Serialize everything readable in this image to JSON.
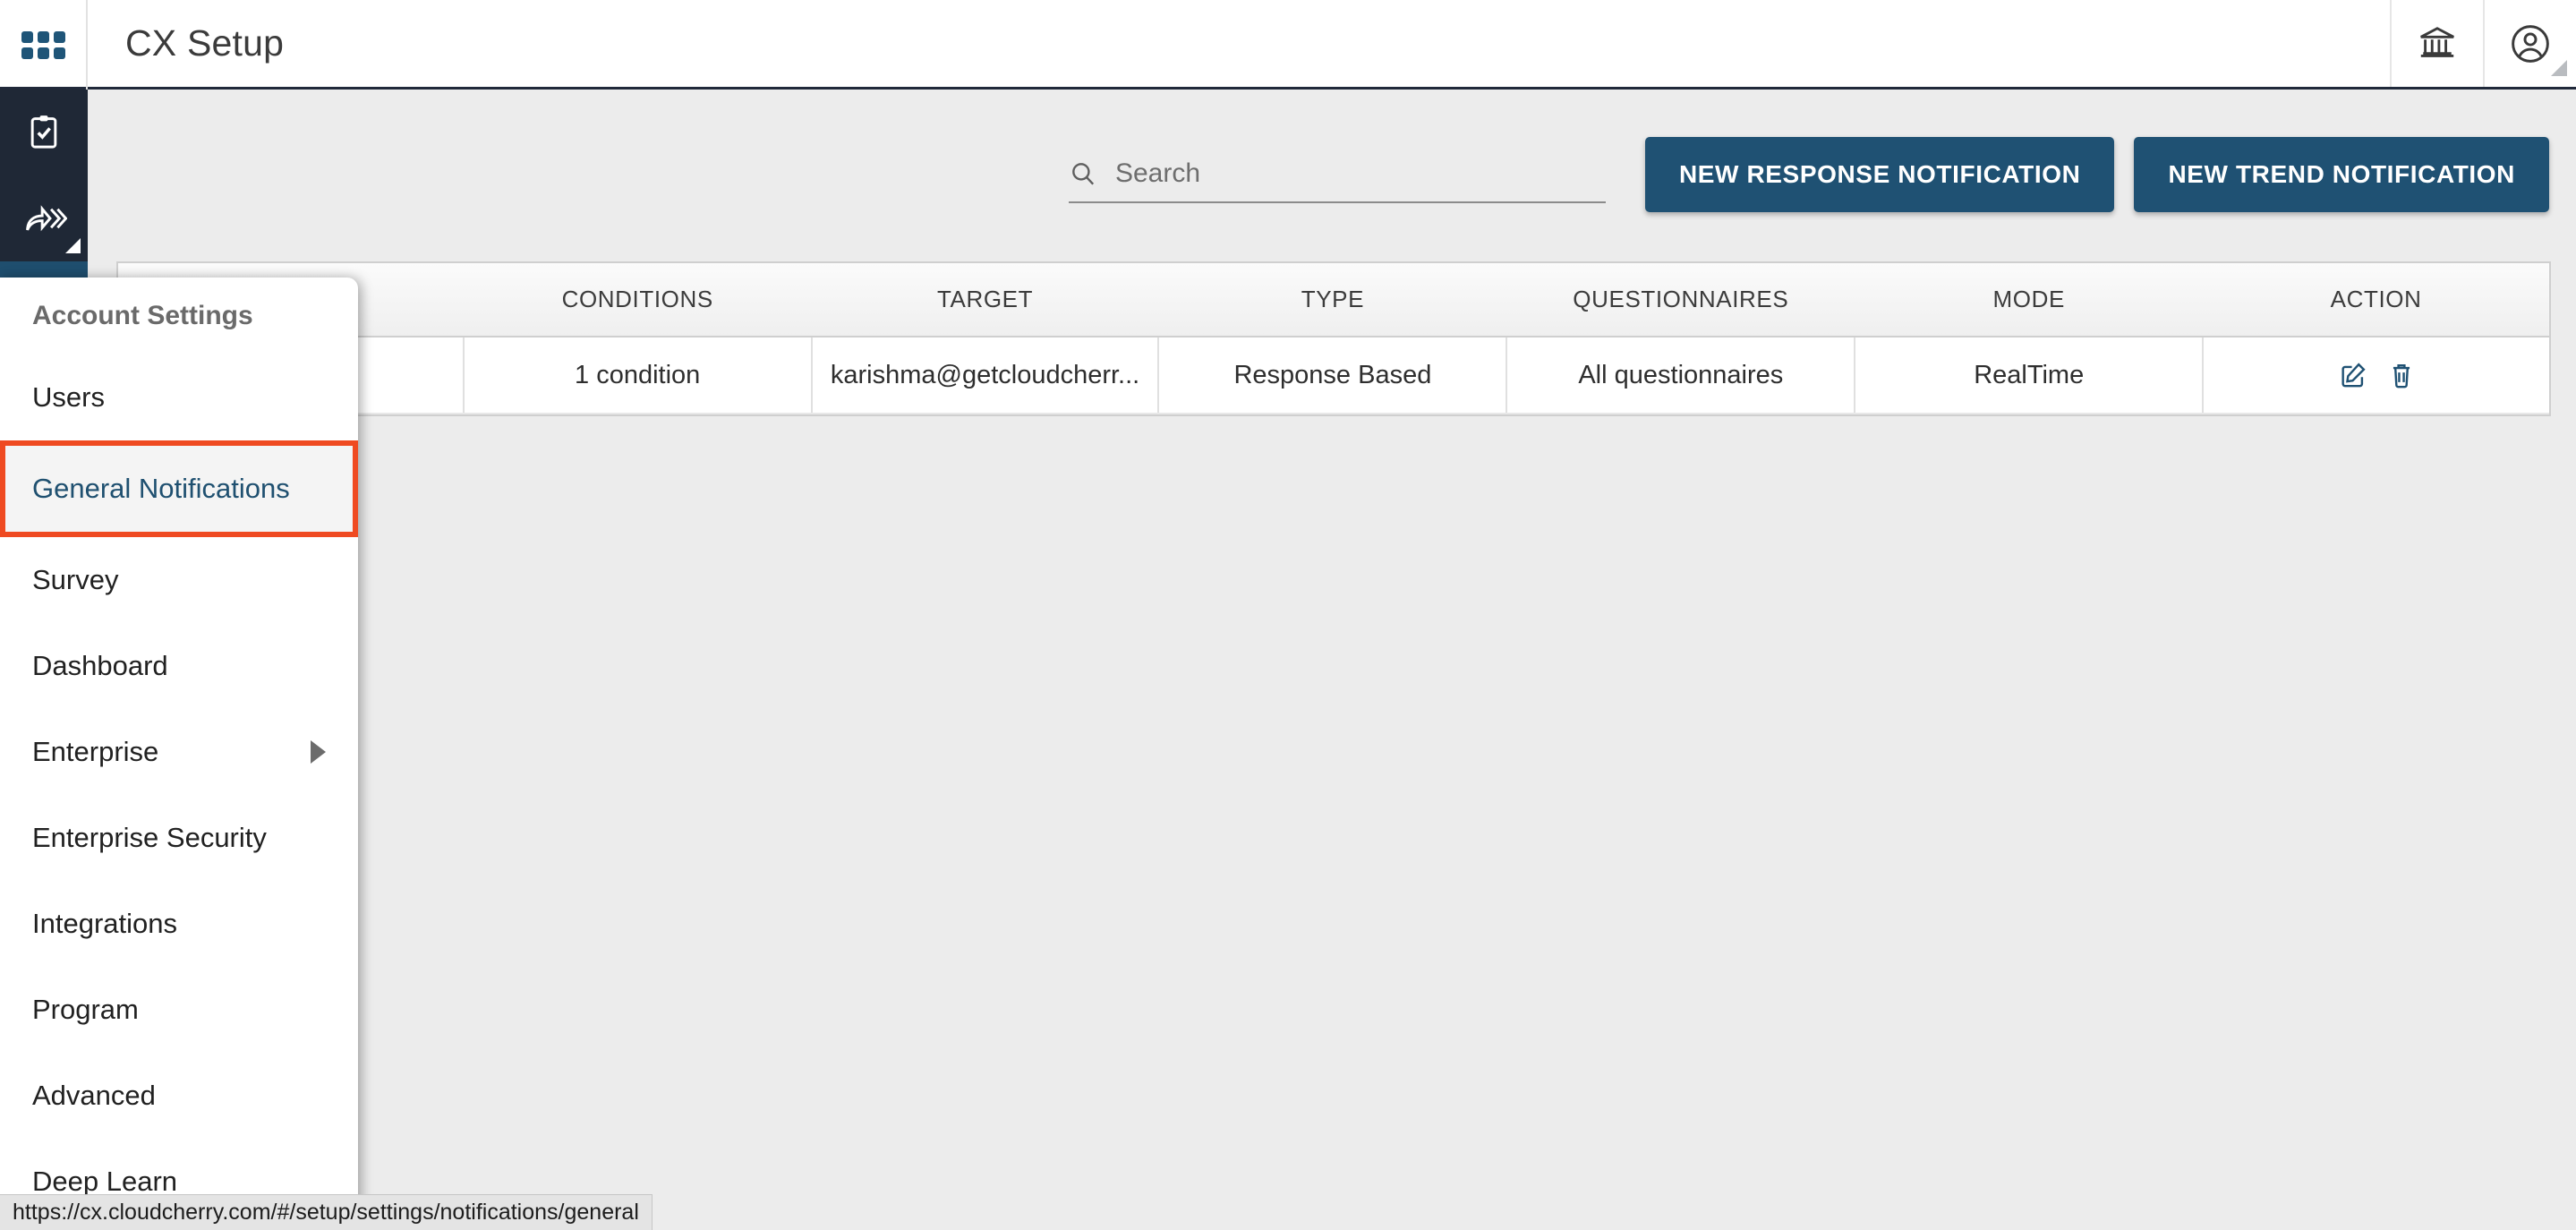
{
  "appbar": {
    "title": "CX Setup",
    "grid_icon": "apps-grid-icon",
    "org_icon": "bank-icon",
    "account_icon": "account-circle-icon"
  },
  "rail": {
    "items": [
      {
        "icon": "clipboard-check-icon",
        "label": "Surveys"
      },
      {
        "icon": "share-forward-icon",
        "label": "Dispatch"
      }
    ]
  },
  "toolbar": {
    "search_placeholder": "Search",
    "search_value": "",
    "search_icon": "search-icon",
    "new_response_notification": "NEW RESPONSE NOTIFICATION",
    "new_trend_notification": "NEW TREND NOTIFICATION"
  },
  "table": {
    "columns": [
      "",
      "CONDITIONS",
      "TARGET",
      "TYPE",
      "QUESTIONNAIRES",
      "MODE",
      "ACTION"
    ],
    "rows": [
      {
        "name": "",
        "conditions": "1 condition",
        "target": "karishma@getcloudcherr...",
        "type": "Response Based",
        "questionnaires": "All questionnaires",
        "mode": "RealTime",
        "edit_icon": "edit-pencil-icon",
        "delete_icon": "trash-icon"
      }
    ]
  },
  "menu": {
    "header": "Account Settings",
    "items": [
      {
        "label": "Users",
        "submenu": false,
        "selected": false
      },
      {
        "label": "General Notifications",
        "submenu": false,
        "selected": true
      },
      {
        "label": "Survey",
        "submenu": false,
        "selected": false
      },
      {
        "label": "Dashboard",
        "submenu": false,
        "selected": false
      },
      {
        "label": "Enterprise",
        "submenu": true,
        "selected": false
      },
      {
        "label": "Enterprise Security",
        "submenu": false,
        "selected": false
      },
      {
        "label": "Integrations",
        "submenu": false,
        "selected": false
      },
      {
        "label": "Program",
        "submenu": false,
        "selected": false
      },
      {
        "label": "Advanced",
        "submenu": false,
        "selected": false
      },
      {
        "label": "Deep Learn",
        "submenu": false,
        "selected": false
      }
    ]
  },
  "statusbar": {
    "url": "https://cx.cloudcherry.com/#/setup/settings/notifications/general"
  },
  "colors": {
    "rail_dark": "#1f2836",
    "rail_accent": "#1f4e6e",
    "primary_button": "#1f5173",
    "highlight_border": "#ef4a21",
    "link_blue": "#1f5070",
    "page_bg": "#ececec"
  }
}
